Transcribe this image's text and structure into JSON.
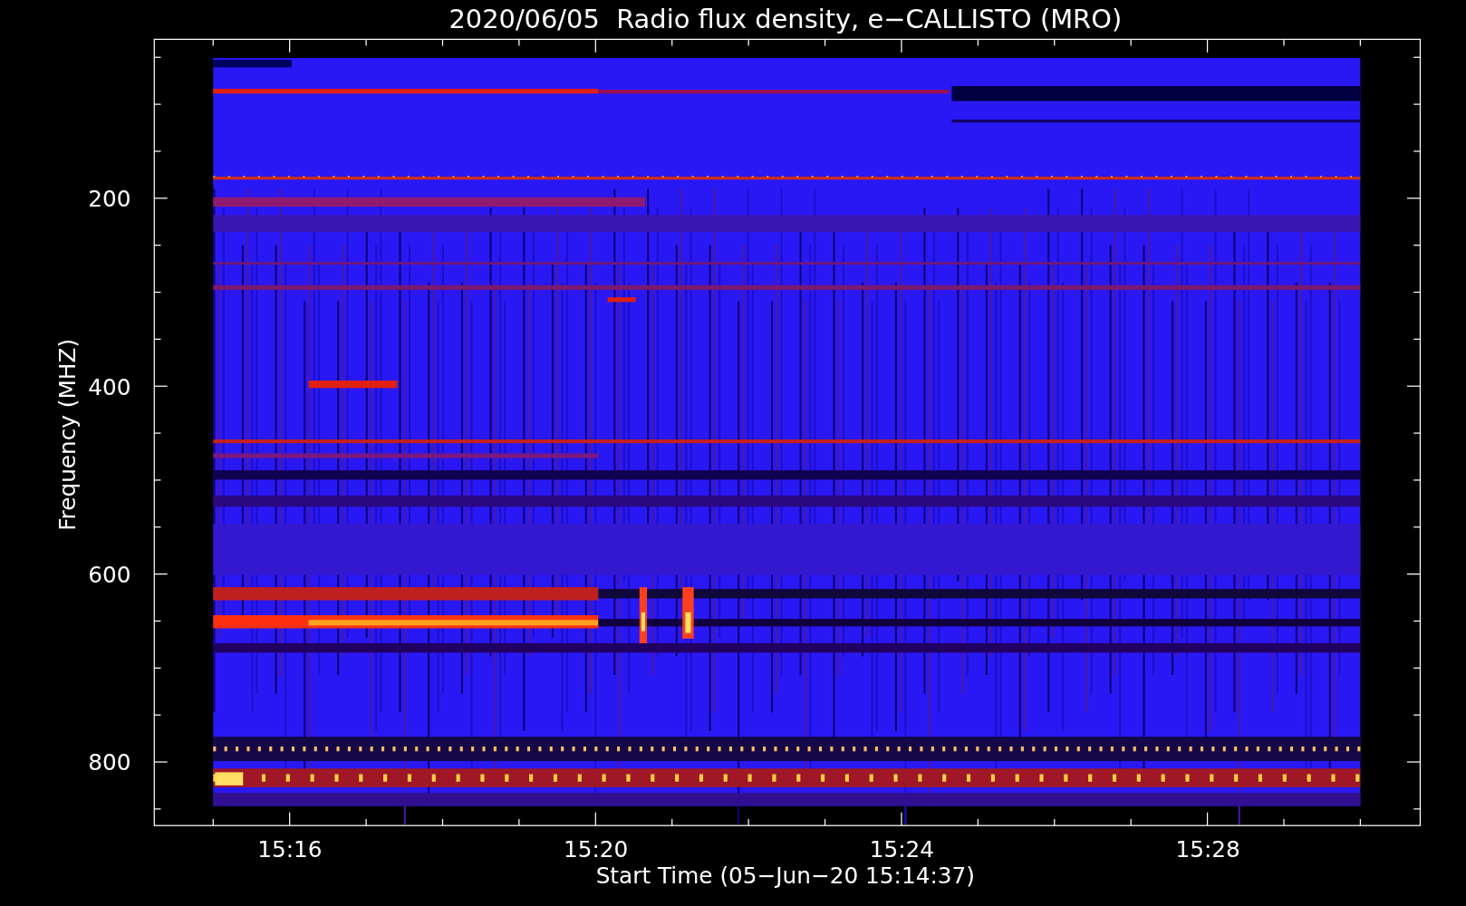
{
  "title": "2020/06/05  Radio flux density, e−CALLISTO (MRO)",
  "plot": {
    "ylabel": "Frequency (MHZ)",
    "xlabel": "Start Time (05−Jun−20 15:14:37)",
    "yticks": [
      "200",
      "400",
      "600",
      "800"
    ],
    "xticks": [
      "15:16",
      "15:20",
      "15:24",
      "15:28"
    ]
  }
}
